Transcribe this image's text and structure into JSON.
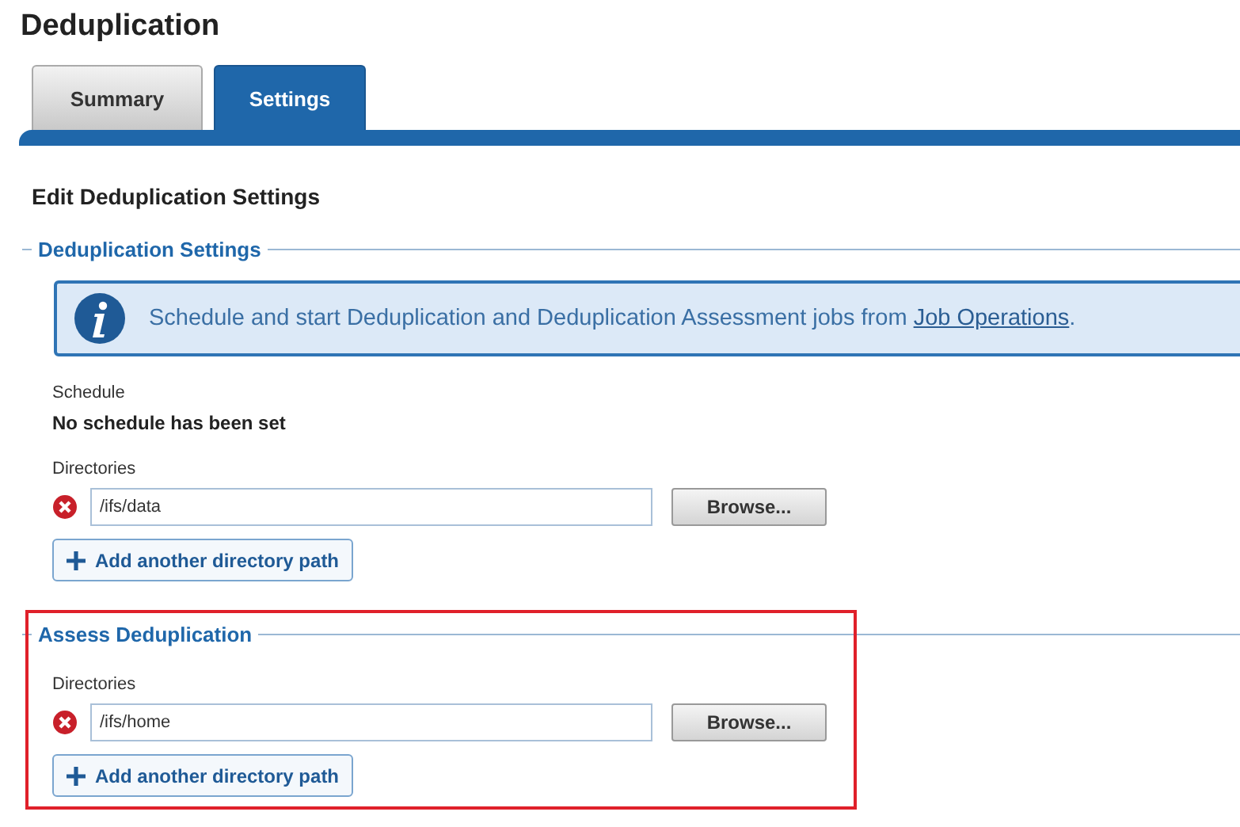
{
  "page_title": "Deduplication",
  "tabs": [
    {
      "label": "Summary",
      "selected": false
    },
    {
      "label": "Settings",
      "selected": true
    }
  ],
  "heading": "Edit Deduplication Settings",
  "sections": [
    {
      "legend": "Deduplication Settings",
      "highlighted": false,
      "info": {
        "before": "Schedule and start Deduplication and Deduplication Assessment jobs from ",
        "link": "Job Operations",
        "after": "."
      },
      "schedule": {
        "label": "Schedule",
        "value": "No schedule has been set"
      },
      "directories": {
        "label": "Directories",
        "paths": [
          {
            "value": "/ifs/data",
            "browse": "Browse..."
          }
        ],
        "add": "Add another directory path"
      }
    },
    {
      "legend": "Assess Deduplication",
      "highlighted": true,
      "directories": {
        "label": "Directories",
        "paths": [
          {
            "value": "/ifs/home",
            "browse": "Browse..."
          }
        ],
        "add": "Add another directory path"
      }
    }
  ]
}
